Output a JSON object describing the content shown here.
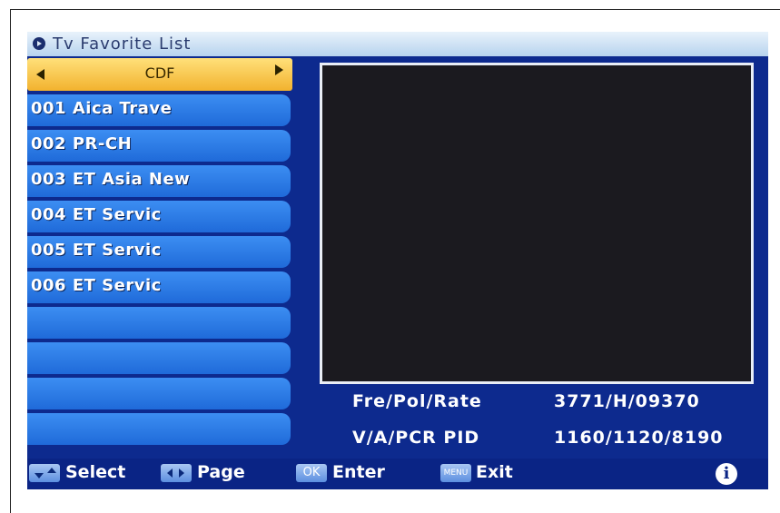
{
  "title": "Tv Favorite List",
  "group": "CDF",
  "channels": [
    "001 Aica Trave",
    "002 PR-CH",
    "003 ET Asia New",
    "004 ET Servic",
    "005 ET Servic",
    "006 ET Servic",
    "",
    "",
    "",
    ""
  ],
  "info": {
    "fre_label": "Fre/Pol/Rate",
    "fre_value": "3771/H/09370",
    "pid_label": "V/A/PCR PID",
    "pid_value": "1160/1120/8190"
  },
  "hints": {
    "select": "Select",
    "page": "Page",
    "ok_key": "OK",
    "enter": "Enter",
    "menu_key": "MENU",
    "exit": "Exit",
    "info_glyph": "i"
  },
  "icons": [
    "play-circle-icon",
    "arrow-left-icon",
    "arrow-right-icon",
    "up-down-key-icon",
    "left-right-key-icon",
    "info-icon"
  ],
  "colors": {
    "background": "#0d2a8e",
    "row": "#2d7ce6",
    "selector": "#f6c24a",
    "preview": "#1b1a1f"
  }
}
